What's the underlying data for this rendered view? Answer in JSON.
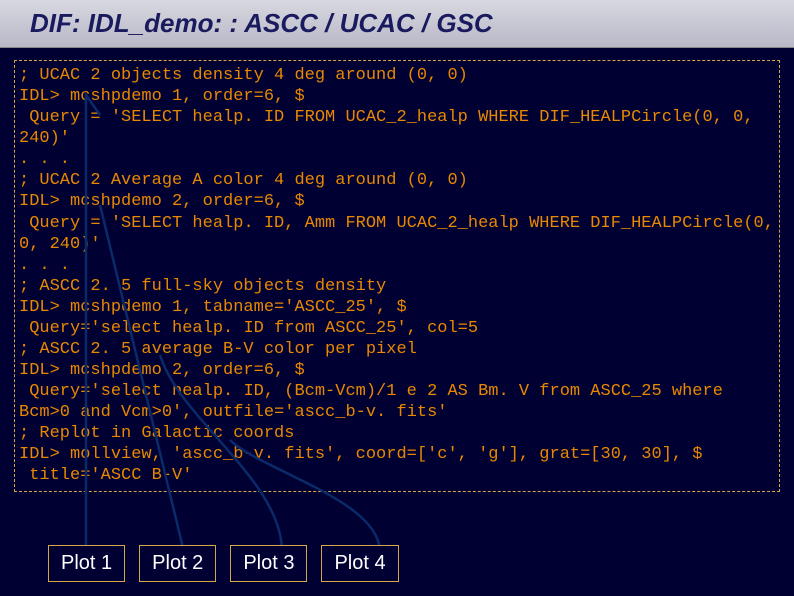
{
  "header": {
    "title": "DIF: IDL_demo: : ASCC / UCAC / GSC"
  },
  "code": {
    "text": "; UCAC 2 objects density 4 deg around (0, 0)\nIDL> mcshpdemo 1, order=6, $\n Query = 'SELECT healp. ID FROM UCAC_2_healp WHERE DIF_HEALPCircle(0, 0, 240)'\n. . .\n; UCAC 2 Average A color 4 deg around (0, 0)\nIDL> mcshpdemo 2, order=6, $\n Query = 'SELECT healp. ID, Amm FROM UCAC_2_healp WHERE DIF_HEALPCircle(0, 0, 240)'\n. . .\n; ASCC 2. 5 full-sky objects density\nIDL> mcshpdemo 1, tabname='ASCC_25', $\n Query='select healp. ID from ASCC_25', col=5\n; ASCC 2. 5 average B-V color per pixel\nIDL> mcshpdemo 2, order=6, $\n Query='select healp. ID, (Bcm-Vcm)/1 e 2 AS Bm. V from ASCC_25 where Bcm>0 and Vcm>0', outfile='ascc_b-v. fits'\n; Replot in Galactic coords\nIDL> mollview, 'ascc_b-v. fits', coord=['c', 'g'], grat=[30, 30], $\n title='ASCC B-V'"
  },
  "buttons": {
    "plot1": "Plot 1",
    "plot2": "Plot 2",
    "plot3": "Plot 3",
    "plot4": "Plot 4"
  }
}
